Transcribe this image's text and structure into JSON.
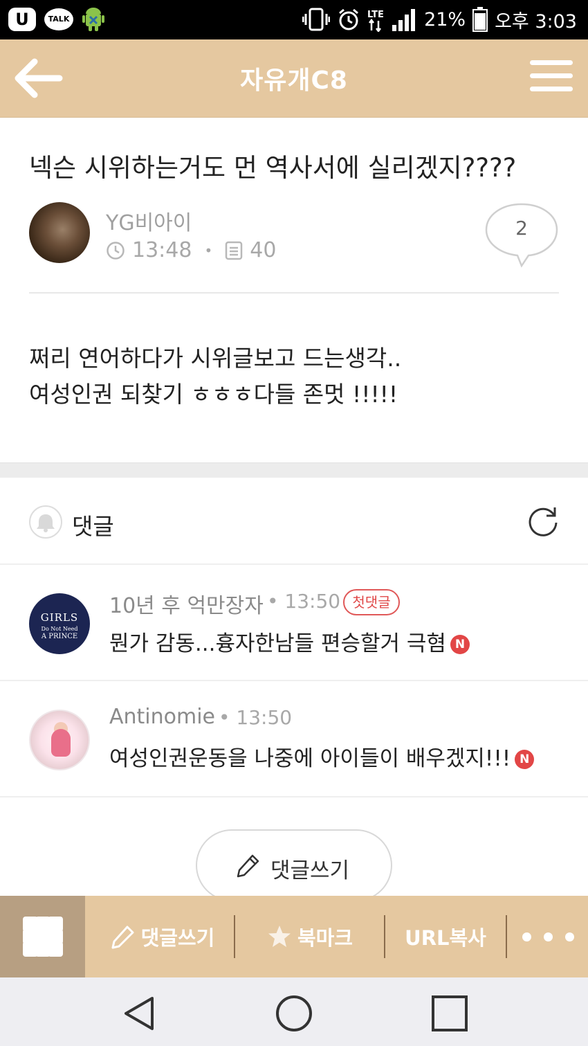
{
  "status_bar": {
    "left_icons": [
      "u-plus-icon",
      "kakaotalk-icon",
      "android-debug-icon"
    ],
    "talk_label": "TALK",
    "battery": "21%",
    "time": "오후 3:03",
    "network": "LTE"
  },
  "app_bar": {
    "title": "자유개C8",
    "back_icon": "arrow-left-icon",
    "menu_icon": "hamburger-icon",
    "color": "#e5c8a0"
  },
  "post": {
    "title": "넥슨 시위하는거도 먼 역사서에 실리겠지????",
    "author": "YG비아이",
    "time": "13:48",
    "views": "40",
    "comment_count": "2",
    "body_lines": [
      "쩌리 연어하다가 시위글보고 드는생각..",
      "여성인권 되찾기 ㅎㅎㅎ다들 존멋 !!!!!"
    ]
  },
  "comments_section": {
    "label": "댓글",
    "items": [
      {
        "author": "10년 후 억만장자",
        "time": "13:50",
        "badge": "첫댓글",
        "text": "뭔가 감동...흉자한남들 편승할거 극혐",
        "new_badge": "N",
        "avatar_text": [
          "GIRLS",
          "Do Not Need",
          "A PRINCE"
        ]
      },
      {
        "author": "Antinomie",
        "time": "13:50",
        "text": "여성인권운동을 나중에 아이들이 배우겠지!!!",
        "new_badge": "N"
      }
    ],
    "write_button": "댓글쓰기"
  },
  "action_bar": {
    "items": [
      "댓글쓰기",
      "북마크",
      "URL복사"
    ],
    "more_icon": "more-dots-icon",
    "grid_icon": "grid-icon",
    "active_color": "#b79f82"
  },
  "nav_bar": {
    "buttons": [
      "back-triangle-icon",
      "home-circle-icon",
      "recents-square-icon"
    ]
  }
}
